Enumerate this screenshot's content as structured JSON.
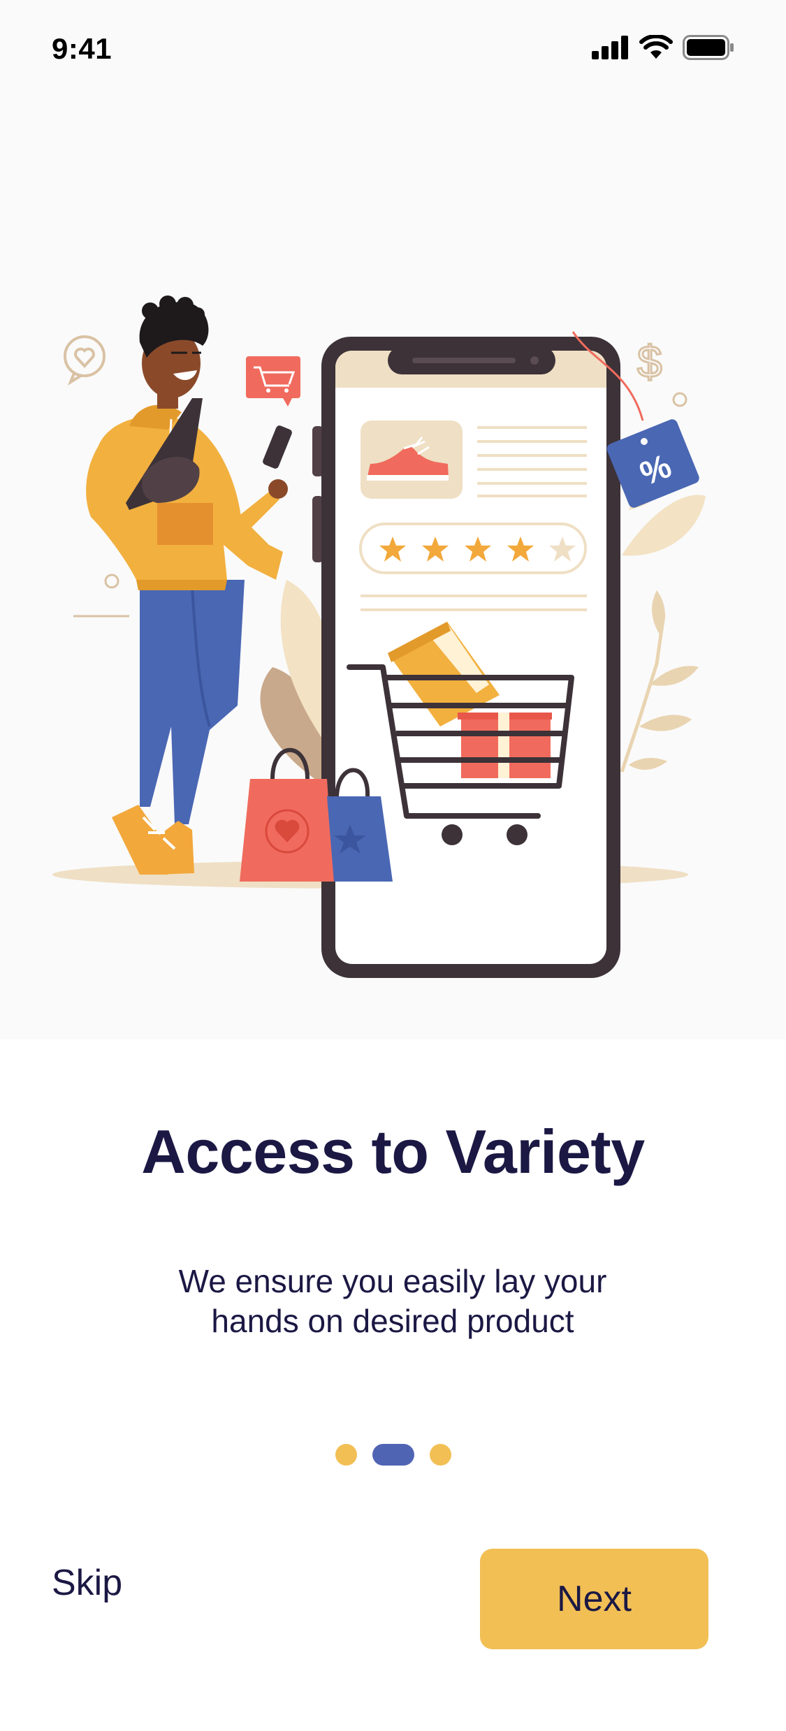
{
  "status_bar": {
    "time": "9:41",
    "icons": [
      "signal-icon",
      "wifi-icon",
      "battery-icon"
    ]
  },
  "hero": {
    "illustration": "shopping-illustration",
    "discount_tag": "%",
    "product_rating": 4.5,
    "rating_max": 5
  },
  "onboarding": {
    "title": "Access to Variety",
    "subtitle_line1": "We ensure you easily lay your",
    "subtitle_line2": "hands on desired product",
    "page_count": 3,
    "current_page": 2
  },
  "actions": {
    "skip_label": "Skip",
    "next_label": "Next"
  },
  "colors": {
    "accent_yellow": "#f2bf55",
    "accent_blue": "#5064b4",
    "text_dark": "#1b1844",
    "hero_background": "#fafafa"
  }
}
